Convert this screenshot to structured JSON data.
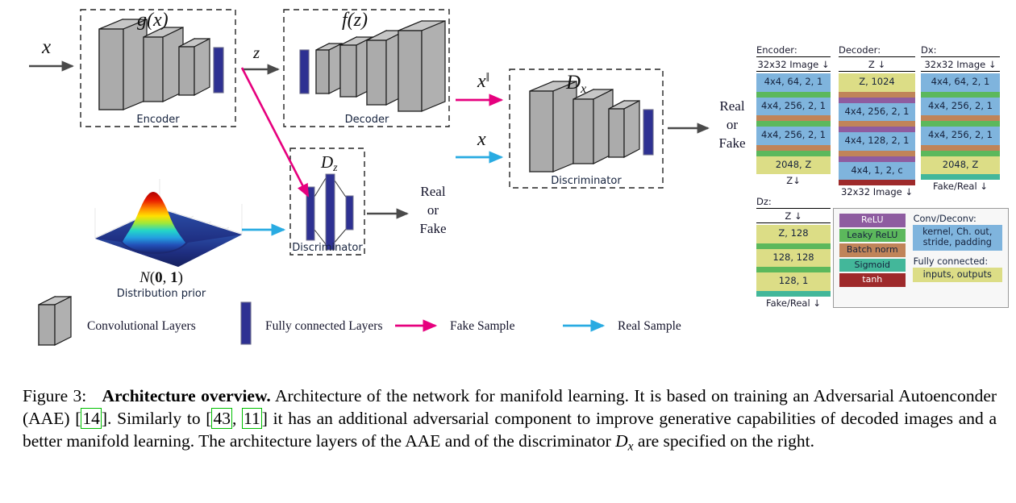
{
  "figure": {
    "labels": {
      "x_input": "x",
      "z_latent": "z",
      "x_recon": "x‖",
      "x_real": "x",
      "g_of_x": "g(x)",
      "f_of_z": "f(z)",
      "dz": "Dz",
      "dx": "Dx",
      "encoder": "Encoder",
      "decoder": "Decoder",
      "discriminator_z": "Discriminator",
      "discriminator_x": "Discriminator",
      "real": "Real",
      "or": "or",
      "fake": "Fake",
      "prior_symbol": "N(0, 1)",
      "prior_caption": "Distribution prior"
    },
    "bottom_legend": [
      {
        "name": "conv-layers",
        "label": "Convolutional Layers",
        "swatch": "gray-box"
      },
      {
        "name": "fc-layers",
        "label": "Fully connected Layers",
        "swatch": "blue-bar"
      },
      {
        "name": "fake-sample",
        "label": "Fake Sample",
        "swatch": "magenta-arrow",
        "color": "#e6007e"
      },
      {
        "name": "real-sample",
        "label": "Real Sample",
        "swatch": "blue-arrow",
        "color": "#29abe2"
      }
    ]
  },
  "colors": {
    "conv": "#7fb4dd",
    "fc": "#dcdd86",
    "relu": "#8e5ca0",
    "leaky_relu": "#5cb85c",
    "batch_norm": "#c08459",
    "sigmoid": "#43b79a",
    "tanh": "#9e2a2b",
    "magenta": "#e6007e",
    "cyan": "#29abe2",
    "conv_box": "#a9a9a9",
    "fc_bar": "#2e3192"
  },
  "specs": {
    "encoder": {
      "title": "Encoder:",
      "input": "32x32 Image ↓",
      "output": "Z↓",
      "layers": [
        {
          "type": "conv",
          "label": "4x4, 64, 2, 1"
        },
        {
          "type": "leaky_relu",
          "label": ""
        },
        {
          "type": "conv",
          "label": "4x4, 256, 2, 1"
        },
        {
          "type": "batch_norm",
          "label": ""
        },
        {
          "type": "leaky_relu",
          "label": ""
        },
        {
          "type": "conv",
          "label": "4x4, 256, 2, 1"
        },
        {
          "type": "batch_norm",
          "label": ""
        },
        {
          "type": "leaky_relu",
          "label": ""
        },
        {
          "type": "fc",
          "label": "2048, Z"
        }
      ]
    },
    "decoder": {
      "title": "Decoder:",
      "input": "Z ↓",
      "output": "32x32 Image ↓",
      "layers": [
        {
          "type": "fc",
          "label": "Z, 1024"
        },
        {
          "type": "batch_norm",
          "label": ""
        },
        {
          "type": "relu",
          "label": ""
        },
        {
          "type": "conv",
          "label": "4x4, 256, 2, 1"
        },
        {
          "type": "batch_norm",
          "label": ""
        },
        {
          "type": "relu",
          "label": ""
        },
        {
          "type": "conv",
          "label": "4x4, 128, 2, 1"
        },
        {
          "type": "batch_norm",
          "label": ""
        },
        {
          "type": "relu",
          "label": ""
        },
        {
          "type": "conv",
          "label": "4x4, 1, 2, c"
        },
        {
          "type": "tanh",
          "label": ""
        }
      ]
    },
    "dx": {
      "title": "Dx:",
      "input": "32x32 Image ↓",
      "output": "Fake/Real ↓",
      "layers": [
        {
          "type": "conv",
          "label": "4x4, 64, 2, 1"
        },
        {
          "type": "leaky_relu",
          "label": ""
        },
        {
          "type": "conv",
          "label": "4x4, 256, 2, 1"
        },
        {
          "type": "batch_norm",
          "label": ""
        },
        {
          "type": "leaky_relu",
          "label": ""
        },
        {
          "type": "conv",
          "label": "4x4, 256, 2, 1"
        },
        {
          "type": "batch_norm",
          "label": ""
        },
        {
          "type": "leaky_relu",
          "label": ""
        },
        {
          "type": "fc",
          "label": "2048, Z"
        },
        {
          "type": "sigmoid",
          "label": ""
        }
      ]
    },
    "dz": {
      "title": "Dz:",
      "input": "Z ↓",
      "output": "Fake/Real ↓",
      "layers": [
        {
          "type": "fc",
          "label": "Z, 128"
        },
        {
          "type": "leaky_relu",
          "label": ""
        },
        {
          "type": "fc",
          "label": "128, 128"
        },
        {
          "type": "leaky_relu",
          "label": ""
        },
        {
          "type": "fc",
          "label": "128, 1"
        },
        {
          "type": "sigmoid",
          "label": ""
        }
      ]
    }
  },
  "legend": {
    "activations": [
      {
        "name": "relu",
        "label": "ReLU",
        "color": "#8e5ca0",
        "text": "light"
      },
      {
        "name": "leaky-relu",
        "label": "Leaky ReLU",
        "color": "#5cb85c",
        "text": "dark"
      },
      {
        "name": "batch-norm",
        "label": "Batch norm",
        "color": "#c08459",
        "text": "dark"
      },
      {
        "name": "sigmoid",
        "label": "Sigmoid",
        "color": "#43b79a",
        "text": "dark"
      },
      {
        "name": "tanh",
        "label": "tanh",
        "color": "#9e2a2b",
        "text": "light"
      }
    ],
    "conv_head": "Conv/Deconv:",
    "conv_desc": "kernel, Ch. out, stride, padding",
    "fc_head": "Fully connected:",
    "fc_desc": "inputs, outputs"
  },
  "caption": {
    "prefix": "Figure 3:",
    "bold": "Architecture overview.",
    "line1_a": "Architecture of the network for manifold learning. It is based",
    "line2_a": "on training an Adversarial Autoenconder (AAE) [",
    "cite1": "14",
    "line2_b": "]. Similarly to [",
    "cite2": "43",
    "line2_c": ", ",
    "cite3": "11",
    "line2_d": "] it has an additional",
    "line3": "adversarial component to improve generative capabilities of decoded images and a better manifold",
    "line4_a": "learning. The architecture layers of the AAE and of the discriminator ",
    "line4_math": "D",
    "line4_sub": "x",
    "line4_b": " are specified on the right."
  }
}
